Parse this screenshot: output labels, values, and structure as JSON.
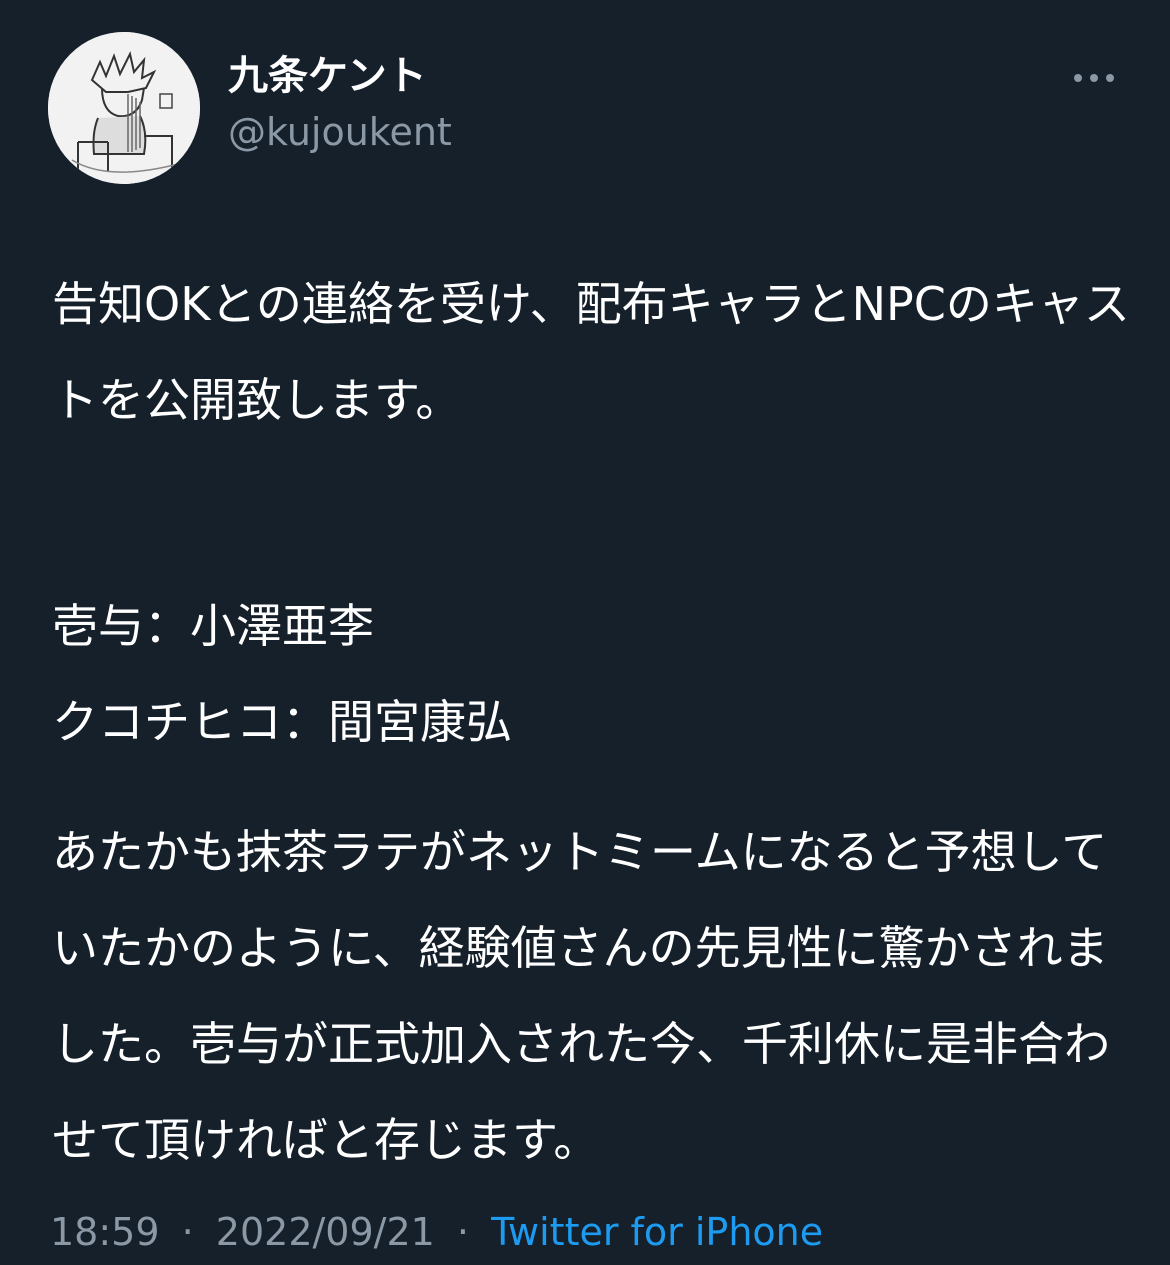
{
  "author": {
    "display_name": "九条ケント",
    "handle": "@kujoukent"
  },
  "tweet": {
    "paragraph_1": "告知OKとの連絡を受け、配布キャラとNPCのキャストを公開致します。",
    "paragraph_2_line_1": "壱与：小澤亜李",
    "paragraph_2_line_2": "クコチヒコ：間宮康弘",
    "paragraph_3": "あたかも抹茶ラテがネットミームになると予想していたかのように、経験値さんの先見性に驚かされました。壱与が正式加入された今、千利休に是非合わせて頂ければと存じます。"
  },
  "meta": {
    "time": "18:59",
    "date": "2022/09/21",
    "separator": "·",
    "source": "Twitter for iPhone"
  },
  "icons": {
    "more": "more-horizontal-icon",
    "avatar": "sketch-avatar"
  },
  "colors": {
    "background": "#15202b",
    "text": "#ffffff",
    "secondary": "#8b98a5",
    "link": "#1d9bf0"
  }
}
